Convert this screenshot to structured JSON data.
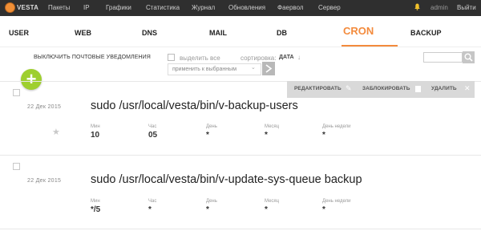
{
  "app": {
    "logo_text": "VESTA",
    "brand_color": "#f08f36",
    "accent_color": "#9ecf2f"
  },
  "topnav": {
    "items": [
      "Пакеты",
      "IP",
      "Графики",
      "Статистика",
      "Журнал",
      "Обновления",
      "Фаервол",
      "Сервер"
    ],
    "user": "admin",
    "logout": "Выйти"
  },
  "tabs": {
    "items": [
      "USER",
      "WEB",
      "DNS",
      "MAIL",
      "DB",
      "CRON",
      "BACKUP"
    ],
    "active": "CRON"
  },
  "toolbar": {
    "notifications_label": "ВЫКЛЮЧИТЬ ПОЧТОВЫЕ УВЕДОМЛЕНИЯ",
    "select_all_label": "выделить все",
    "sort_label": "сортировка:",
    "sort_value": "ДАТА",
    "sort_arrow": "↓",
    "apply_select_value": "применить к выбранным",
    "search_placeholder": ""
  },
  "add_button": {
    "symbol": "+"
  },
  "row_actions": {
    "edit": "РЕДАКТИРОВАТЬ",
    "suspend": "ЗАБЛОКИРОВАТЬ",
    "delete": "УДАЛИТЬ"
  },
  "field_labels": {
    "min": "Мин",
    "hour": "Час",
    "day": "День",
    "month": "Месяц",
    "weekday": "День недели"
  },
  "jobs": [
    {
      "date": "22  Дек  2015",
      "command": "sudo /usr/local/vesta/bin/v-backup-users",
      "min": "10",
      "hour": "05",
      "day": "*",
      "month": "*",
      "weekday": "*"
    },
    {
      "date": "22  Дек  2015",
      "command": "sudo /usr/local/vesta/bin/v-update-sys-queue backup",
      "min": "*/5",
      "hour": "*",
      "day": "*",
      "month": "*",
      "weekday": "*"
    }
  ]
}
